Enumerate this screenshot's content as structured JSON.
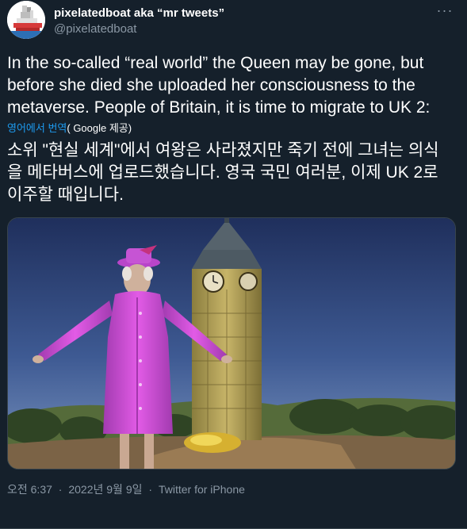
{
  "author": {
    "display_name": "pixelatedboat aka “mr tweets”",
    "handle": "@pixelatedboat",
    "avatar_icon": "pixel-boat-avatar"
  },
  "more_icon": "more-dots-icon",
  "tweet": {
    "text_en": "In the so-called “real world” the Queen may be gone, but before she died she uploaded her consciousness to the metaverse. People of Britain, it is time to migrate to UK 2:",
    "translate_link": "영어에서 번역",
    "translate_by": "( Google 제공)",
    "text_ko": "소위 \"현실 세계\"에서 여왕은 사라졌지만 죽기 전에 그녀는 의식을 메타버스에 업로드했습니다. 영국 국민 여러분, 이제 UK 2로 이주할 때입니다."
  },
  "media": {
    "description_icon": "metaverse-queen-bigben-image"
  },
  "meta": {
    "time": "오전 6:37",
    "date": "2022년 9월 9일",
    "separator": "·",
    "source": "Twitter for iPhone"
  },
  "colors": {
    "background": "#15202b",
    "text": "#ffffff",
    "secondary": "#8b98a5",
    "link": "#1d9bf0",
    "border": "#38444d"
  }
}
